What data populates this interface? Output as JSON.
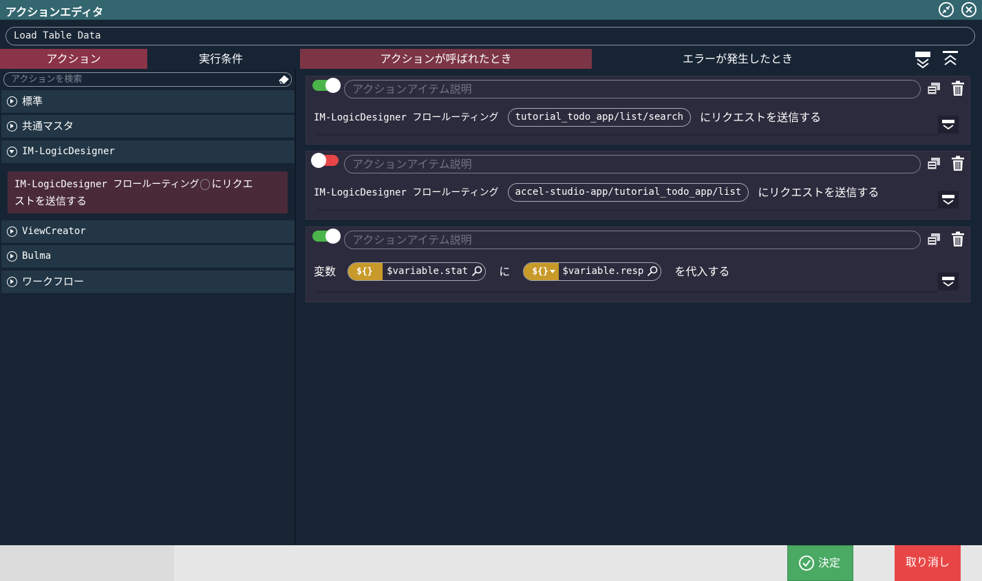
{
  "window": {
    "title": "アクションエディタ"
  },
  "name_input": {
    "value": "Load Table Data"
  },
  "left_tabs": [
    {
      "label": "アクション"
    },
    {
      "label": "実行条件"
    }
  ],
  "right_tabs": [
    {
      "label": "アクションが呼ばれたとき"
    },
    {
      "label": "エラーが発生したとき"
    }
  ],
  "search": {
    "placeholder": "アクションを検索"
  },
  "categories": [
    {
      "label": "標準"
    },
    {
      "label": "共通マスタ"
    },
    {
      "label": "IM-LogicDesigner"
    },
    {
      "label": "ViewCreator"
    },
    {
      "label": "Bulma"
    },
    {
      "label": "ワークフロー"
    }
  ],
  "category_item": {
    "line1": "IM-LogicDesigner フロールーティング",
    "line1b": "にリクエ",
    "line2": "ストを送信する"
  },
  "actions": [
    {
      "enabled": true,
      "desc_placeholder": "アクションアイテム説明",
      "prefix": "IM-LogicDesigner フロールーティング",
      "route": "tutorial_todo_app/list/search",
      "suffix": "にリクエストを送信する"
    },
    {
      "enabled": false,
      "desc_placeholder": "アクションアイテム説明",
      "prefix": "IM-LogicDesigner フロールーティング",
      "route": "accel-studio-app/tutorial_todo_app/list",
      "suffix": "にリクエストを送信する"
    },
    {
      "enabled": true,
      "desc_placeholder": "アクションアイテム説明",
      "label_var": "変数",
      "badge1": "${}",
      "var1": "$variable.stat",
      "label_ni": "に",
      "badge2": "${}",
      "var2": "$variable.resp",
      "suffix": "を代入する"
    }
  ],
  "footer": {
    "ok_label": "決定",
    "cancel_label": "取り消し"
  },
  "colors": {
    "titlebar": "#33666f",
    "active_tab": "#8b3447",
    "toggle_on": "#4bb54b",
    "toggle_off": "#e84646",
    "ok": "#4aa963",
    "cancel": "#e84646"
  }
}
